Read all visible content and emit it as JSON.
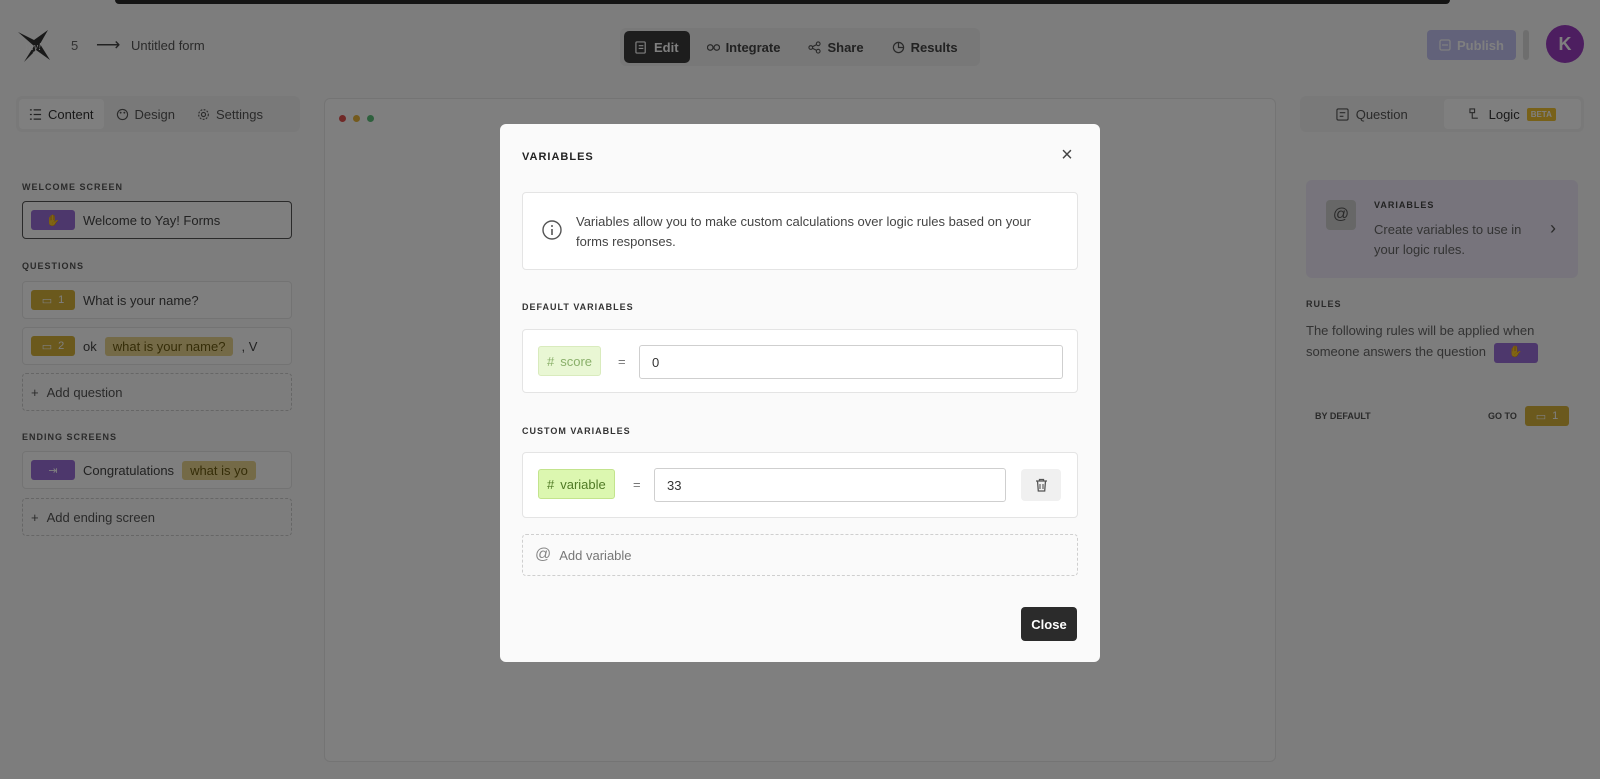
{
  "header": {
    "form_number": "5",
    "arrow": "⟶",
    "form_title": "Untitled form",
    "nav": [
      {
        "label": "Edit"
      },
      {
        "label": "Integrate"
      },
      {
        "label": "Share"
      },
      {
        "label": "Results"
      }
    ],
    "publish_label": "Publish",
    "avatar_initial": "K"
  },
  "left_panel": {
    "tabs": [
      {
        "label": "Content"
      },
      {
        "label": "Design"
      },
      {
        "label": "Settings"
      }
    ],
    "welcome_label": "WELCOME SCREEN",
    "welcome_item": "Welcome to Yay! Forms",
    "questions_label": "QUESTIONS",
    "questions": [
      {
        "num": "1",
        "text": "What is your name?"
      },
      {
        "num": "2",
        "prefix": "ok",
        "tag": "what is your name?",
        "suffix": ", V"
      }
    ],
    "add_question": "Add question",
    "ending_label": "ENDING SCREENS",
    "ending_item": {
      "text": "Congratulations",
      "tag": "what is yo"
    },
    "add_ending": "Add ending screen"
  },
  "right_panel": {
    "tabs": [
      {
        "label": "Question"
      },
      {
        "label": "Logic"
      }
    ],
    "beta": "BETA",
    "variables_card": {
      "title": "VARIABLES",
      "desc": "Create variables to use in your logic rules."
    },
    "rules_label": "RULES",
    "rules_desc": "The following rules will be applied when someone answers the question",
    "by_default": "BY DEFAULT",
    "go_to": "GO TO",
    "go_to_num": "1"
  },
  "modal": {
    "title": "VARIABLES",
    "info": "Variables allow you to make custom calculations over logic rules based on your forms responses.",
    "default_label": "DEFAULT VARIABLES",
    "default_var": {
      "name": "score",
      "eq": "=",
      "value": "0"
    },
    "custom_label": "CUSTOM VARIABLES",
    "custom_var": {
      "name": "variable",
      "eq": "=",
      "value": "33"
    },
    "add_variable": "Add variable",
    "close_label": "Close"
  },
  "colors": {
    "accent_purple": "#9a6ed8",
    "accent_yellow": "#d6b23a",
    "avatar": "#9b3cc1",
    "primary_dark": "#2b2b2b"
  }
}
